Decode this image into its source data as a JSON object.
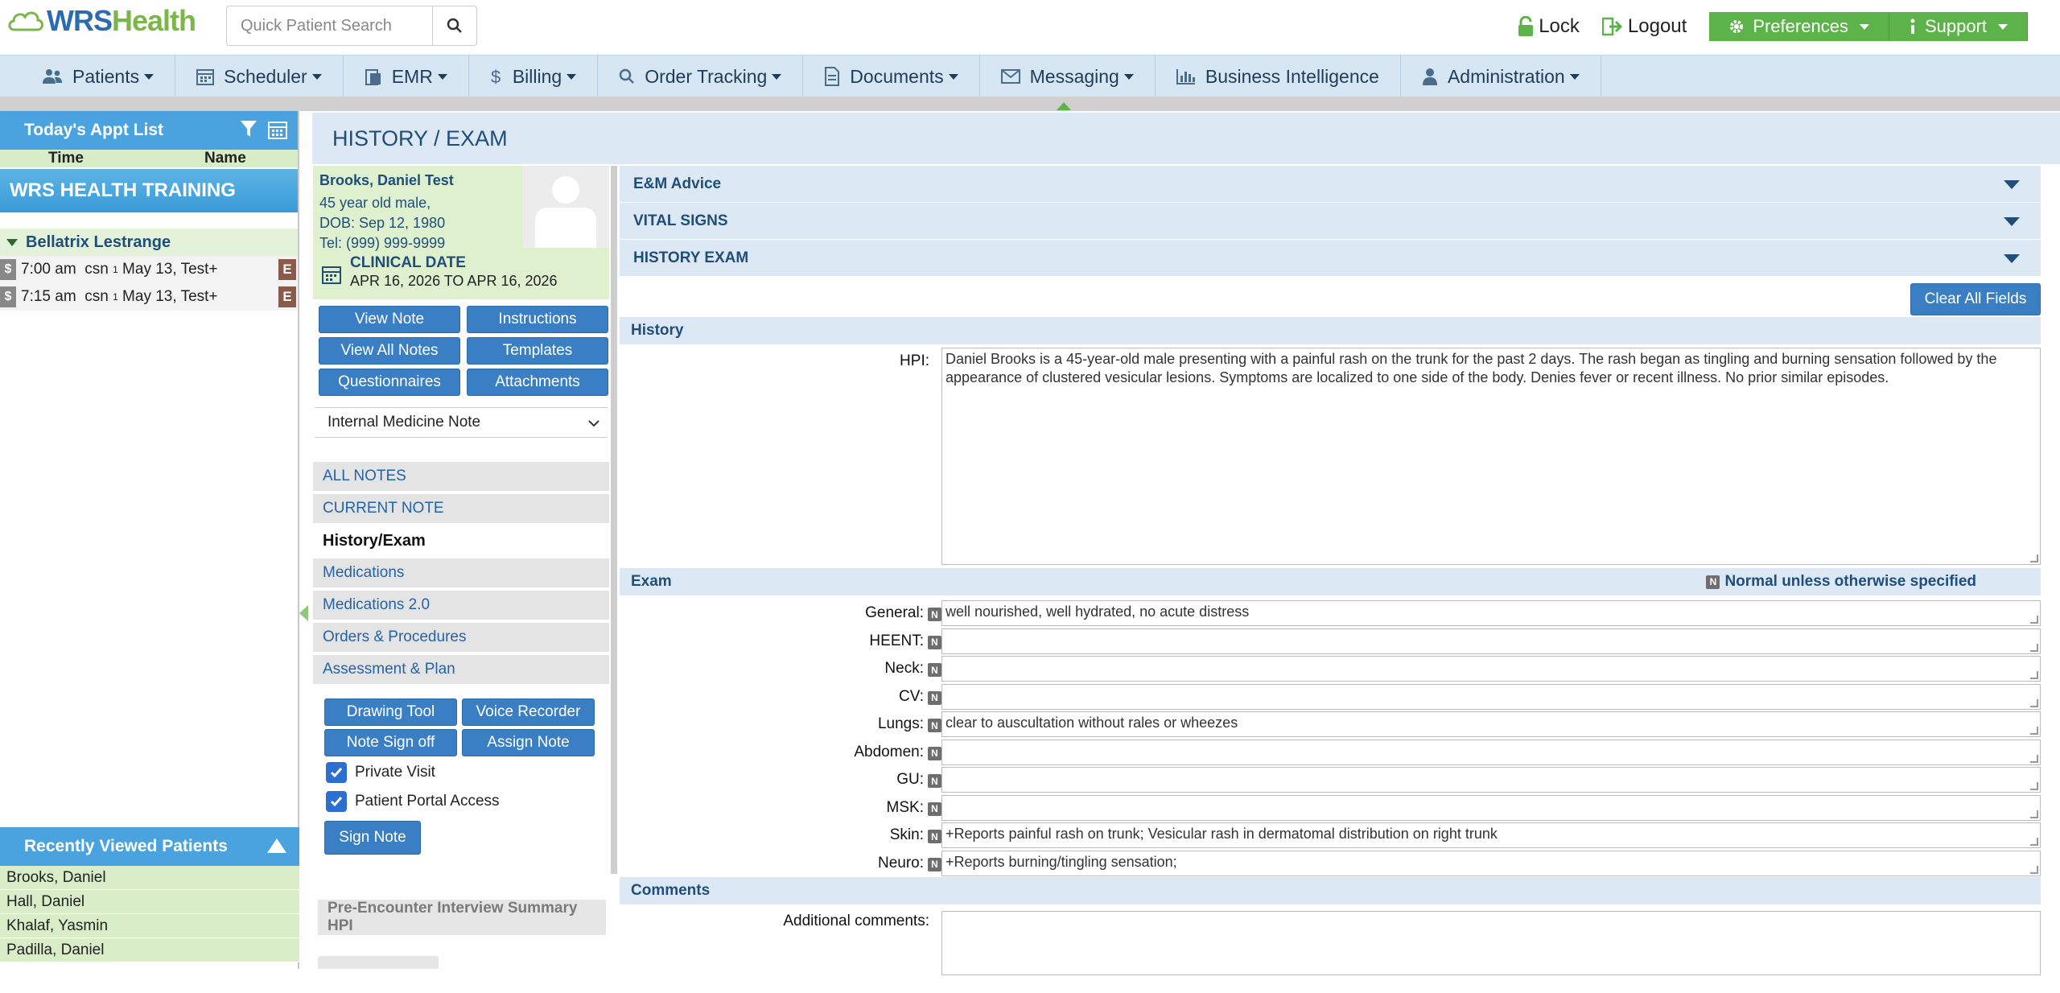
{
  "brand": {
    "logo_w": "WRS",
    "logo_h": "Health"
  },
  "search": {
    "placeholder": "Quick Patient Search"
  },
  "top_links": {
    "lock": "Lock",
    "logout": "Logout",
    "preferences": "Preferences",
    "support": "Support"
  },
  "nav": [
    {
      "label": "Patients",
      "icon": "users-icon"
    },
    {
      "label": "Scheduler",
      "icon": "calendar-icon"
    },
    {
      "label": "EMR",
      "icon": "clipboard-icon"
    },
    {
      "label": "Billing",
      "icon": "dollar-icon"
    },
    {
      "label": "Order Tracking",
      "icon": "search-icon"
    },
    {
      "label": "Documents",
      "icon": "document-icon"
    },
    {
      "label": "Messaging",
      "icon": "envelope-icon"
    },
    {
      "label": "Business Intelligence",
      "icon": "bar-chart-icon"
    },
    {
      "label": "Administration",
      "icon": "user-icon"
    }
  ],
  "appt_list": {
    "title": "Today's Appt List",
    "col_time": "Time",
    "col_name": "Name",
    "training": "WRS HEALTH TRAINING",
    "patient": "Bellatrix Lestrange",
    "rows": [
      {
        "dollar": "$",
        "time": "7:00 am",
        "code": "csn",
        "sup": "1",
        "desc": "May 13, Test+",
        "badge": "E"
      },
      {
        "dollar": "$",
        "time": "7:15 am",
        "code": "csn",
        "sup": "1",
        "desc": "May 13, Test+",
        "badge": "E"
      }
    ]
  },
  "recent": {
    "title": "Recently Viewed Patients",
    "items": [
      "Brooks, Daniel",
      "Hall, Daniel",
      "Khalaf, Yasmin",
      "Padilla, Daniel"
    ]
  },
  "page_title": "HISTORY / EXAM",
  "patient": {
    "name": "Brooks, Daniel Test",
    "age": "45 year old male,",
    "dob": "DOB: Sep 12, 1980",
    "tel": "Tel: (999) 999-9999",
    "clinical_label": "CLINICAL DATE",
    "clinical_range": "APR 16, 2026 TO APR 16, 2026"
  },
  "note_buttons": [
    "View Note",
    "Instructions",
    "View All Notes",
    "Templates",
    "Questionnaires",
    "Attachments"
  ],
  "note_type": "Internal Medicine Note",
  "note_nav": {
    "all_notes": "ALL NOTES",
    "current_note": "CURRENT NOTE",
    "items": [
      "History/Exam",
      "Medications",
      "Medications 2.0",
      "Orders & Procedures",
      "Assessment & Plan"
    ]
  },
  "action_buttons": [
    "Drawing Tool",
    "Voice Recorder",
    "Note Sign off",
    "Assign Note"
  ],
  "checks": {
    "private_visit": "Private Visit",
    "portal_access": "Patient Portal Access"
  },
  "sign_note": "Sign Note",
  "pre_encounter": "Pre-Encounter Interview Summary HPI",
  "accordions": [
    "E&M Advice",
    "VITAL SIGNS",
    "HISTORY EXAM"
  ],
  "clear_all": "Clear All Fields",
  "history": {
    "title": "History",
    "hpi_label": "HPI:",
    "hpi_text": "Daniel Brooks is a 45-year-old male presenting with a painful rash on the trunk for the past 2 days. The rash began as tingling and burning sensation followed by the appearance of clustered vesicular lesions. Symptoms are localized to one side of the body. Denies fever or recent illness. No prior similar episodes."
  },
  "exam": {
    "title": "Exam",
    "normal_note": "Normal unless otherwise specified",
    "n_badge": "N",
    "rows": [
      {
        "label": "General:",
        "value": "well nourished, well hydrated, no acute distress"
      },
      {
        "label": "HEENT:",
        "value": ""
      },
      {
        "label": "Neck:",
        "value": ""
      },
      {
        "label": "CV:",
        "value": ""
      },
      {
        "label": "Lungs:",
        "value": "clear to auscultation without rales or wheezes"
      },
      {
        "label": "Abdomen:",
        "value": ""
      },
      {
        "label": "GU:",
        "value": ""
      },
      {
        "label": "MSK:",
        "value": ""
      },
      {
        "label": "Skin:",
        "value": "+Reports painful rash on trunk; Vesicular rash in dermatomal distribution on right trunk"
      },
      {
        "label": "Neuro:",
        "value": "+Reports burning/tingling sensation;"
      }
    ]
  },
  "comments": {
    "title": "Comments",
    "label": "Additional comments:",
    "value": ""
  }
}
